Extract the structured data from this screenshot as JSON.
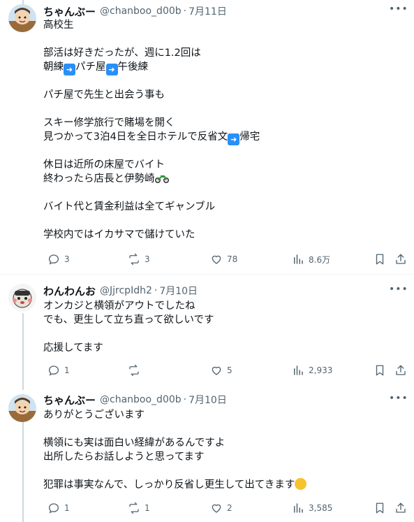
{
  "tweets": [
    {
      "name": "ちゃんぶー",
      "handle": "@chanboo_d00b",
      "sep": "·",
      "date": "7月11日",
      "lines": [
        "高校生",
        "",
        "部活は好きだったが、週に1.2回は",
        "朝練{arrow}パチ屋{arrow}午後練",
        "",
        "パチ屋で先生と出会う事も",
        "",
        "スキー修学旅行で賭場を開く",
        "見つかって3泊4日を全日ホテルで反省文{arrow}帰宅",
        "",
        "休日は近所の床屋でバイト",
        "終わったら店長と伊勢崎{bike}",
        "",
        "バイト代と賃金利益は全てギャンブル",
        "",
        "学校内ではイカサマで儲けていた"
      ],
      "replies": "3",
      "reposts": "3",
      "likes": "78",
      "views": "8.6万"
    },
    {
      "name": "わんわんお",
      "handle": "@JjrcpIdh2",
      "sep": "·",
      "date": "7月10日",
      "lines": [
        "オンカジと横領がアウトでしたね",
        "でも、更生して立ち直って欲しいです",
        "",
        "応援してます"
      ],
      "replies": "1",
      "reposts": "",
      "likes": "5",
      "views": "2,933"
    },
    {
      "name": "ちゃんぶー",
      "handle": "@chanboo_d00b",
      "sep": "·",
      "date": "7月10日",
      "lines": [
        "ありがとうございます",
        "",
        "横領にも実は面白い経緯があるんですよ",
        "出所したらお話しようと思ってます",
        "",
        "犯罪は事実なんで、しっかり反省し更生して出てきます{fist}"
      ],
      "replies": "1",
      "reposts": "1",
      "likes": "2",
      "views": "3,585"
    }
  ],
  "icons": {
    "more": "more-horizontal-icon",
    "reply": "reply-icon",
    "repost": "repost-icon",
    "like": "heart-icon",
    "views": "views-icon",
    "bookmark": "bookmark-icon",
    "share": "share-icon"
  },
  "colors": {
    "text": "#0f1419",
    "secondary": "#536471",
    "thread_line": "#cfd9de",
    "emoji_arrow": "#2a8ff7"
  }
}
